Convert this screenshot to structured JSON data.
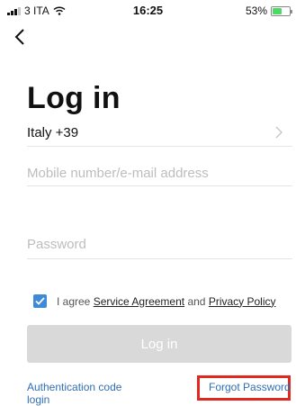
{
  "status_bar": {
    "carrier": "3 ITA",
    "time": "16:25",
    "battery_percent": "53%",
    "battery_level": 0.53,
    "battery_color": "#4cd964"
  },
  "nav": {
    "back_icon": "chevron-left-icon"
  },
  "page": {
    "title": "Log in"
  },
  "form": {
    "country": "Italy +39",
    "mobile_placeholder": "Mobile number/e-mail address",
    "password_placeholder": "Password",
    "agreement": {
      "checked": true,
      "prefix": "I agree",
      "service_link": "Service Agreement",
      "conjunction": "and",
      "privacy_link": "Privacy Policy"
    },
    "login_label": "Log in"
  },
  "links": {
    "auth_code_login": "Authentication code login",
    "forgot_password": "Forgot Password"
  },
  "colors": {
    "accent": "#3f8ad8",
    "link": "#2f6fb2",
    "disabled_button": "#d9d9d9",
    "highlight_box": "#e0281e"
  }
}
